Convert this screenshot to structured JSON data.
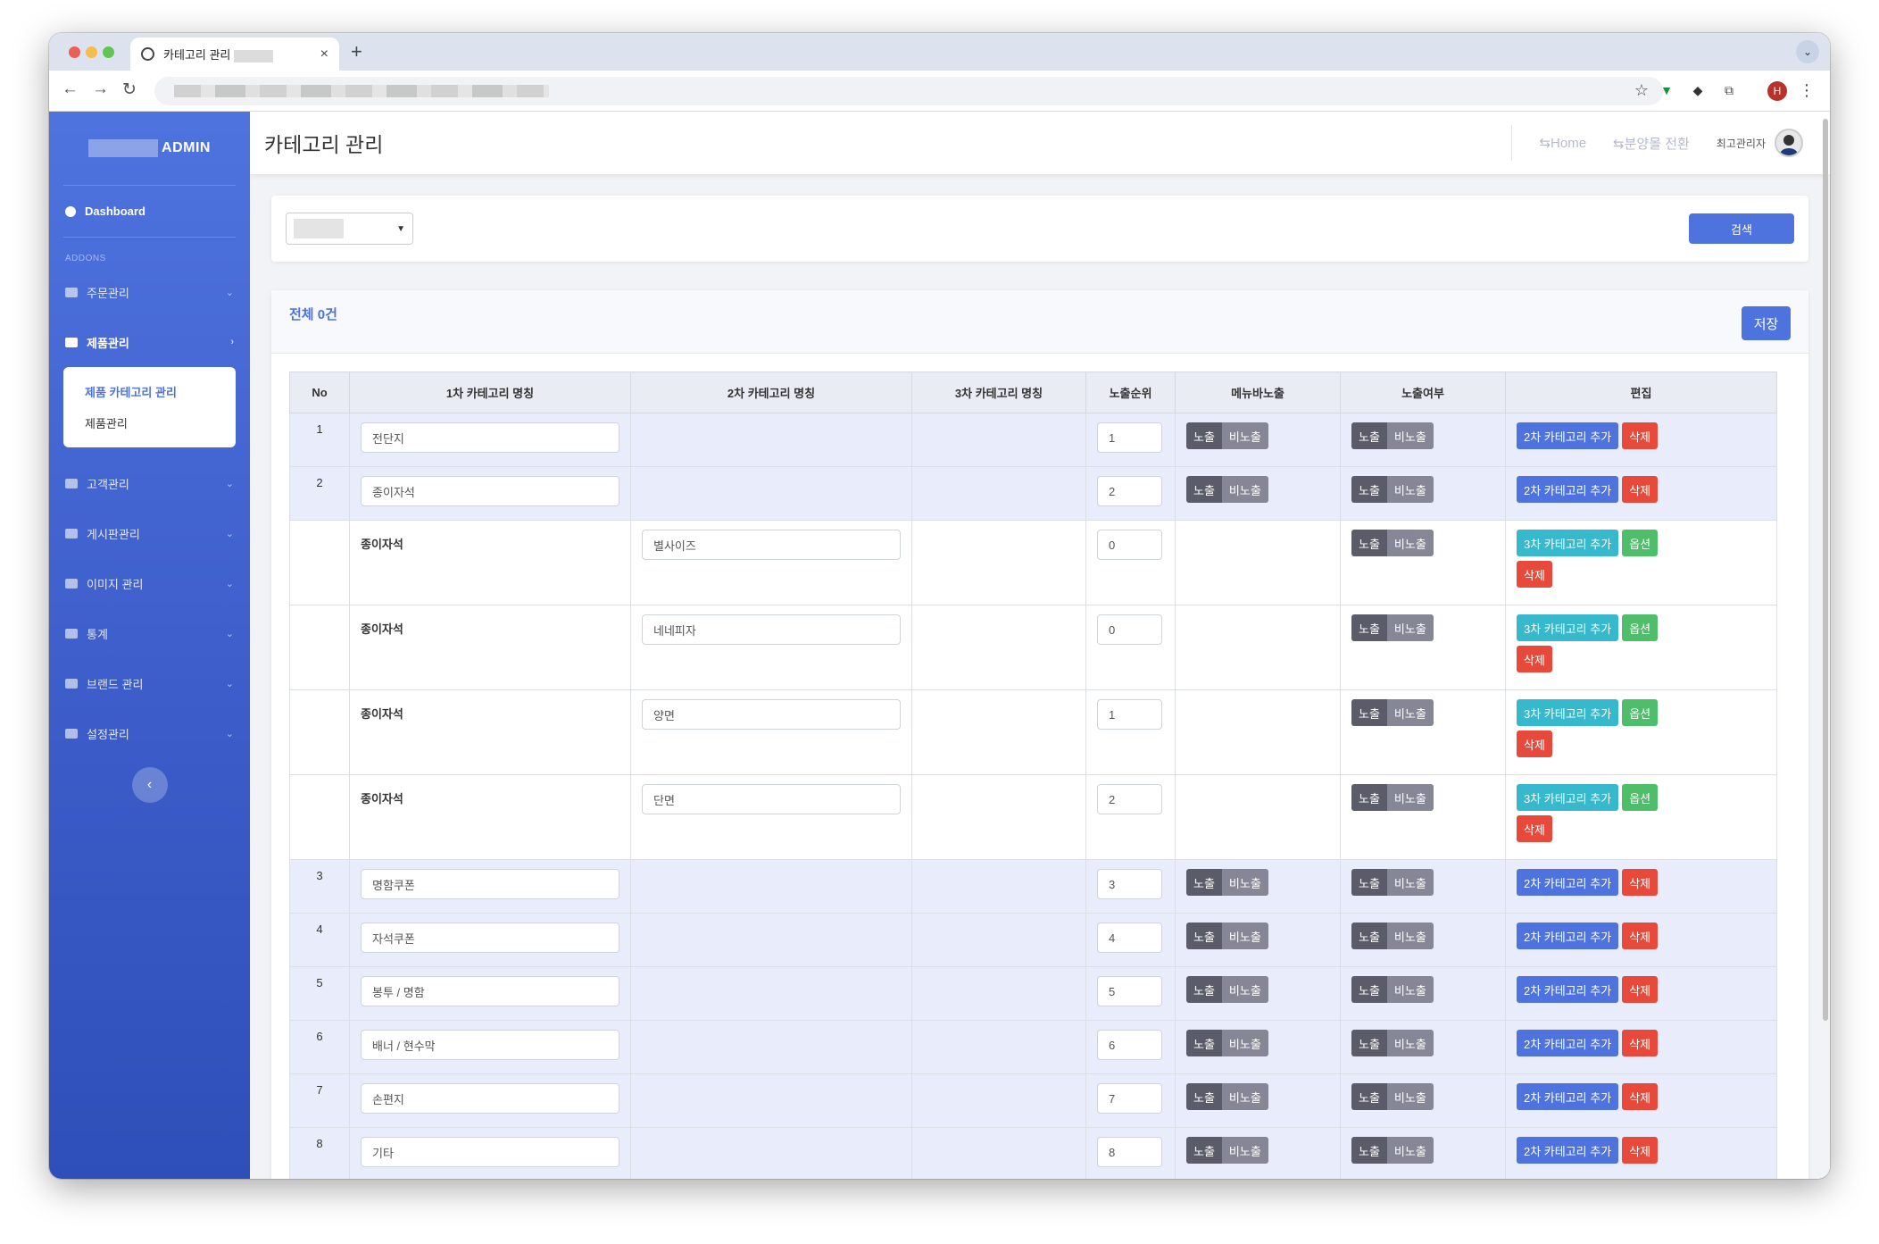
{
  "browser": {
    "tab_title": "카테고리 관리",
    "new_tab": "+",
    "close_tab": "×",
    "profile_initial": "H",
    "back": "←",
    "forward": "→",
    "reload": "↻",
    "bookmark": "☆",
    "menu": "⋮",
    "tab_menu": "⌄"
  },
  "sidebar": {
    "brand": "ADMIN",
    "dashboard": "Dashboard",
    "section": "ADDONS",
    "items": [
      {
        "label": "주문관리"
      },
      {
        "label": "제품관리"
      },
      {
        "label": "고객관리"
      },
      {
        "label": "게시판관리"
      },
      {
        "label": "이미지 관리"
      },
      {
        "label": "통계"
      },
      {
        "label": "브랜드 관리"
      },
      {
        "label": "설정관리"
      }
    ],
    "submenu": [
      "제품 카테고리 관리",
      "제품관리"
    ],
    "collapse": "‹"
  },
  "topbar": {
    "title": "카테고리 관리",
    "home": "Home",
    "switch": "분양몰 전환",
    "user": "최고관리자"
  },
  "search": {
    "button": "검색"
  },
  "list": {
    "count": "전체 0건",
    "save": "저장",
    "headers": [
      "No",
      "1차 카테고리 명칭",
      "2차 카테고리 명칭",
      "3차 카테고리 명칭",
      "노출순위",
      "메뉴바노출",
      "노출여부",
      "편집"
    ],
    "show": "노출",
    "hide": "비노출",
    "add2": "2차 카테고리 추가",
    "add3": "3차 카테고리 추가",
    "option": "옵션",
    "delete": "삭제",
    "rows": [
      {
        "level": 1,
        "no": "1",
        "name1": "전단지",
        "order": "1"
      },
      {
        "level": 1,
        "no": "2",
        "name1": "종이자석",
        "order": "2"
      },
      {
        "level": 2,
        "parent": "종이자석",
        "name2": "별사이즈",
        "order": "0"
      },
      {
        "level": 2,
        "parent": "종이자석",
        "name2": "네네피자",
        "order": "0"
      },
      {
        "level": 2,
        "parent": "종이자석",
        "name2": "양면",
        "order": "1"
      },
      {
        "level": 2,
        "parent": "종이자석",
        "name2": "단면",
        "order": "2"
      },
      {
        "level": 1,
        "no": "3",
        "name1": "명함쿠폰",
        "order": "3"
      },
      {
        "level": 1,
        "no": "4",
        "name1": "자석쿠폰",
        "order": "4"
      },
      {
        "level": 1,
        "no": "5",
        "name1": "봉투 / 명함",
        "order": "5"
      },
      {
        "level": 1,
        "no": "6",
        "name1": "배너 / 현수막",
        "order": "6"
      },
      {
        "level": 1,
        "no": "7",
        "name1": "손편지",
        "order": "7"
      },
      {
        "level": 1,
        "no": "8",
        "name1": "기타",
        "order": "8"
      }
    ]
  }
}
